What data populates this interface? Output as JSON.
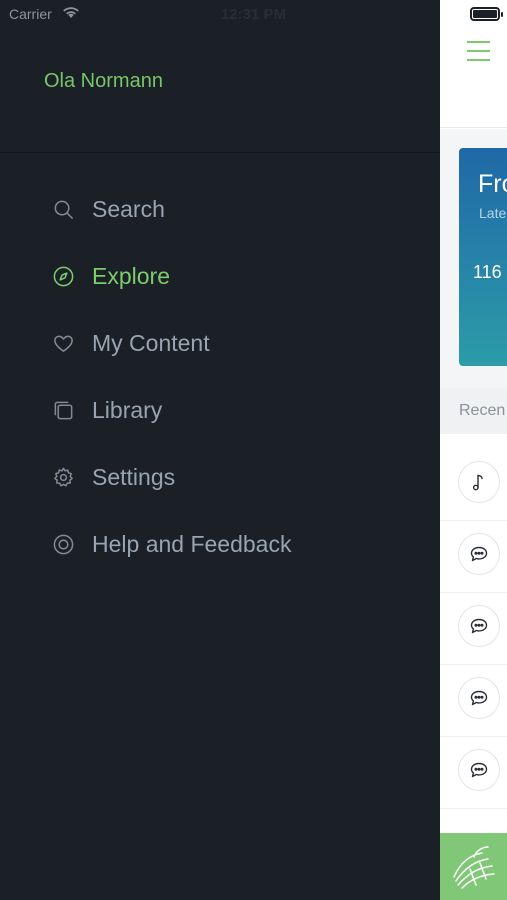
{
  "status": {
    "carrier": "Carrier",
    "time": "12:31 PM"
  },
  "drawer": {
    "user_name": "Ola Normann",
    "menu": [
      {
        "label": "Search",
        "icon": "search-icon"
      },
      {
        "label": "Explore",
        "icon": "compass-icon",
        "active": true
      },
      {
        "label": "My Content",
        "icon": "heart-icon"
      },
      {
        "label": "Library",
        "icon": "library-icon"
      },
      {
        "label": "Settings",
        "icon": "gear-icon"
      },
      {
        "label": "Help and Feedback",
        "icon": "lifebuoy-icon"
      }
    ]
  },
  "main": {
    "hero": {
      "title": "Fro",
      "subtitle": "Late",
      "count": "116"
    },
    "section_label": "Recen",
    "list_icons": [
      "music-note-icon",
      "chat-bubble-icon",
      "chat-bubble-icon",
      "chat-bubble-icon",
      "chat-bubble-icon"
    ]
  },
  "colors": {
    "drawer_bg": "#1b1f26",
    "accent": "#7ccc6e",
    "menu_text": "#98a4b2",
    "hero_gradient_top": "#1f68a6",
    "hero_gradient_bottom": "#2b9ca8"
  }
}
